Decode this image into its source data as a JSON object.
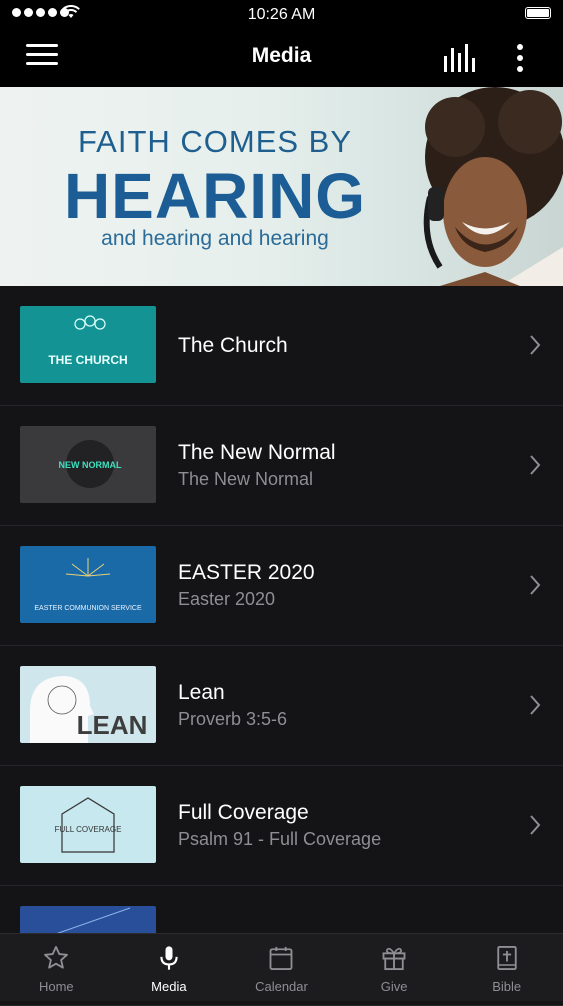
{
  "status_bar": {
    "time": "10:26 AM"
  },
  "header": {
    "title": "Media"
  },
  "banner": {
    "line1": "FAITH COMES BY",
    "line2": "HEARING",
    "line3": "and hearing and hearing"
  },
  "media_items": [
    {
      "title": "The Church",
      "subtitle": "",
      "thumb_text": "THE CHURCH"
    },
    {
      "title": "The New Normal",
      "subtitle": "The New Normal",
      "thumb_text": "NEW NORMAL"
    },
    {
      "title": "EASTER 2020",
      "subtitle": "Easter 2020",
      "thumb_text": "EASTER COMMUNION SERVICE"
    },
    {
      "title": "Lean",
      "subtitle": "Proverb 3:5-6",
      "thumb_text": "LEAN"
    },
    {
      "title": "Full Coverage",
      "subtitle": "Psalm 91 - Full Coverage",
      "thumb_text": "FULL COVERAGE"
    }
  ],
  "tabs": [
    {
      "label": "Home",
      "icon": "star-icon"
    },
    {
      "label": "Media",
      "icon": "microphone-icon",
      "active": true
    },
    {
      "label": "Calendar",
      "icon": "calendar-icon"
    },
    {
      "label": "Give",
      "icon": "gift-icon"
    },
    {
      "label": "Bible",
      "icon": "bible-icon"
    }
  ],
  "colors": {
    "background": "#141416",
    "bar": "#000000",
    "banner_text": "#1c5d95",
    "subtitle": "#8e8e93"
  }
}
